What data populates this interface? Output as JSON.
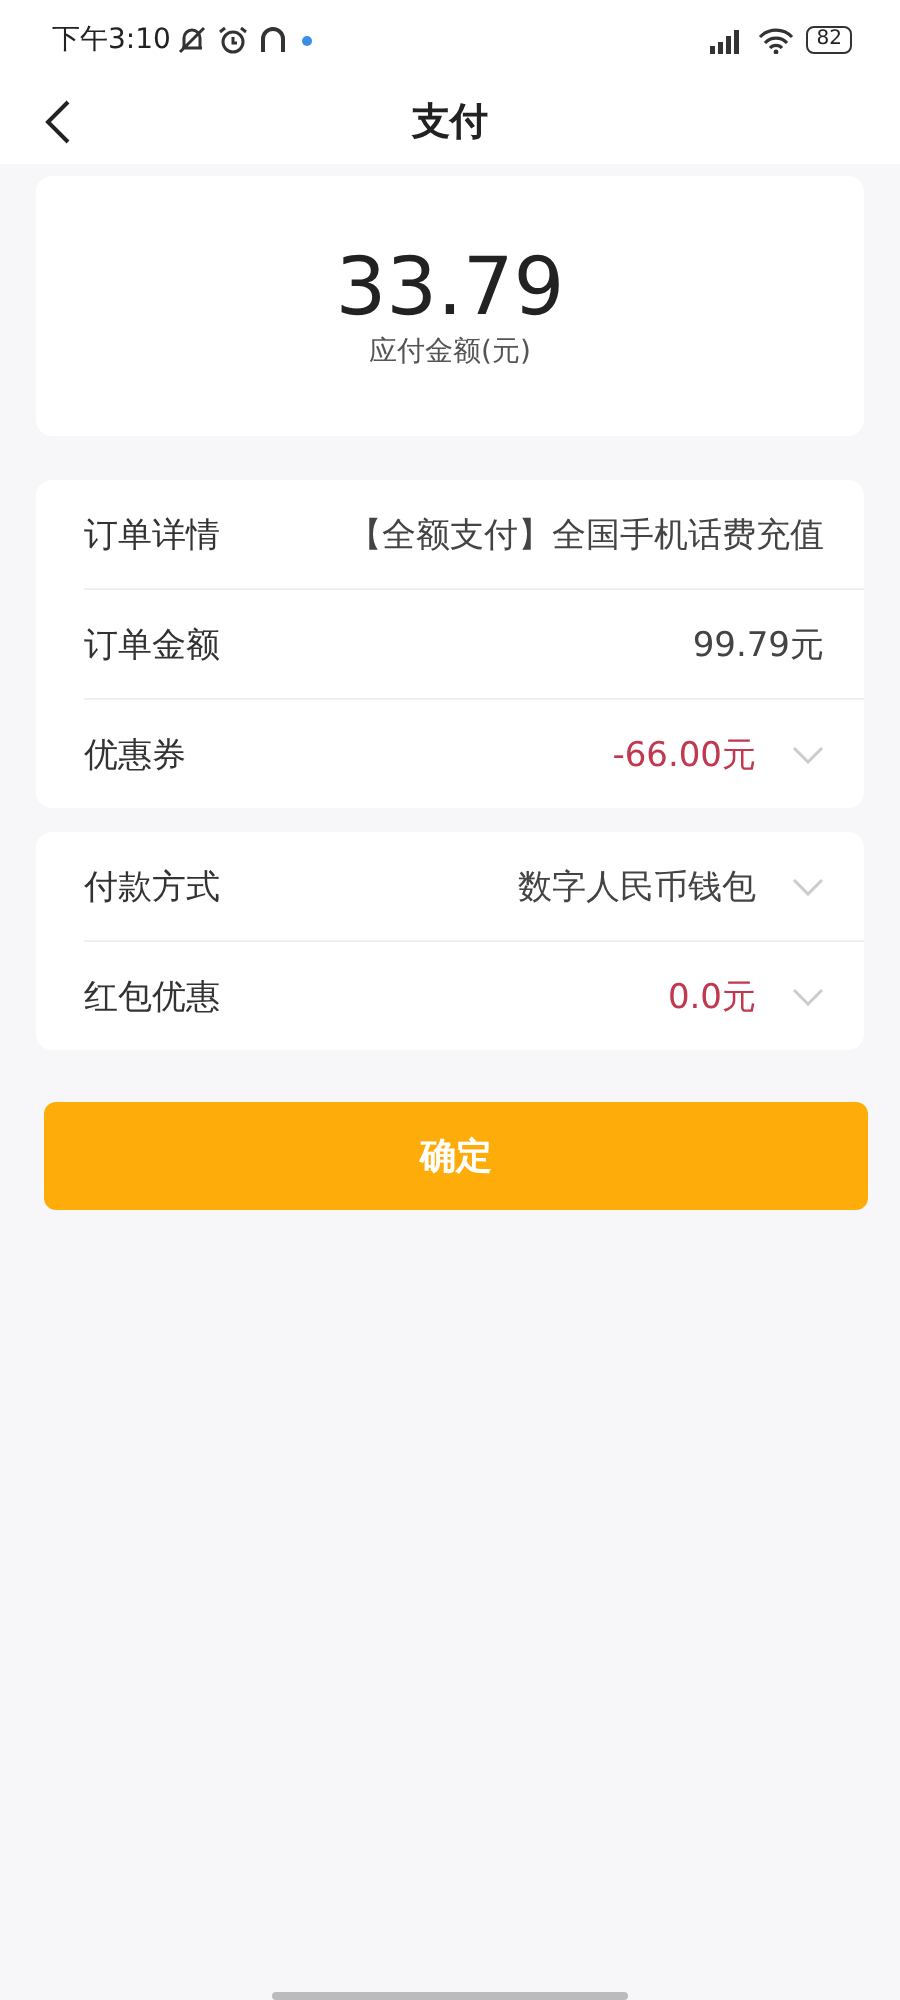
{
  "status_bar": {
    "time": "下午3:10",
    "battery": "82"
  },
  "nav": {
    "title": "支付"
  },
  "amount": {
    "value": "33.79",
    "label": "应付金额(元)"
  },
  "groups": [
    {
      "rows": [
        {
          "label": "订单详情",
          "value": "【全额支付】全国手机话费充值",
          "highlight": false,
          "dropdown": false
        },
        {
          "label": "订单金额",
          "value": "99.79元",
          "highlight": false,
          "dropdown": false
        },
        {
          "label": "优惠券",
          "value": "-66.00元",
          "highlight": true,
          "dropdown": true
        }
      ]
    },
    {
      "rows": [
        {
          "label": "付款方式",
          "value": "数字人民币钱包",
          "highlight": false,
          "dropdown": true
        },
        {
          "label": "红包优惠",
          "value": "0.0元",
          "highlight": true,
          "dropdown": true
        }
      ]
    }
  ],
  "confirm_button": "确定"
}
